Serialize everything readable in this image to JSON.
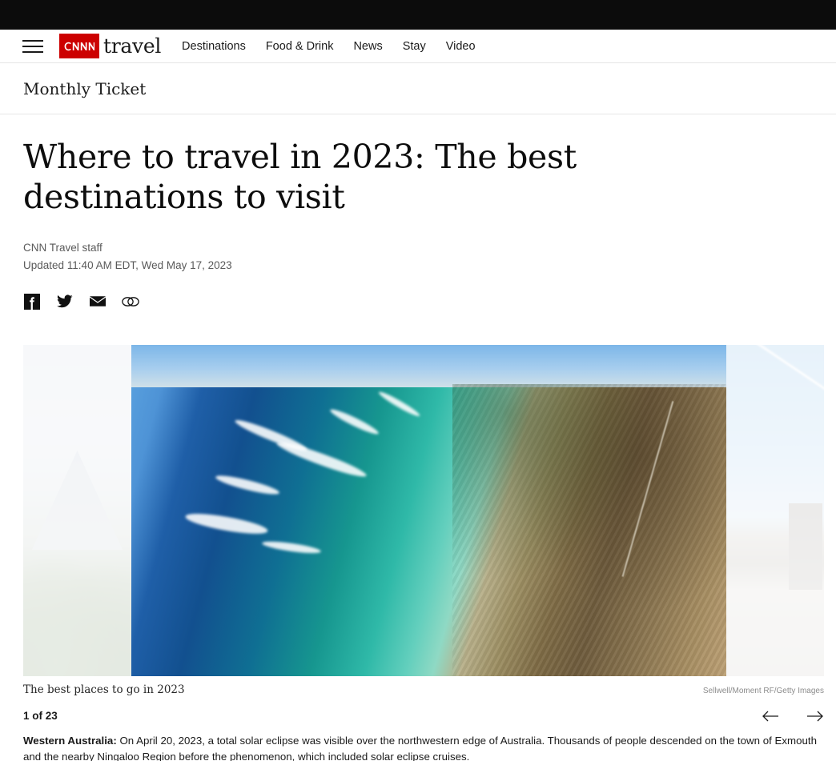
{
  "topbar": {
    "present": true
  },
  "header": {
    "menu_label": "Menu",
    "brand": {
      "logo_text": "CNN",
      "word": "travel",
      "logo_bg": "#cc0000"
    },
    "nav": [
      {
        "label": "Destinations"
      },
      {
        "label": "Food & Drink"
      },
      {
        "label": "News"
      },
      {
        "label": "Stay"
      },
      {
        "label": "Video"
      }
    ]
  },
  "section": {
    "label": "Monthly Ticket"
  },
  "article": {
    "headline": "Where to travel in 2023: The best destinations to visit",
    "author": "CNN Travel staff",
    "timestamp": "Updated 11:40 AM EDT, Wed May 17, 2023",
    "share": [
      {
        "name": "facebook",
        "label": "Share on Facebook"
      },
      {
        "name": "twitter",
        "label": "Share on Twitter"
      },
      {
        "name": "email",
        "label": "Share by email"
      },
      {
        "name": "link",
        "label": "Copy link"
      }
    ]
  },
  "gallery": {
    "caption": "The best places to go in 2023",
    "credit": "Sellwell/Moment RF/Getty Images",
    "counter": "1 of 23",
    "prev_label": "Previous image",
    "next_label": "Next image",
    "slides": [
      {
        "position": "previous",
        "alt": "Misty mountain and forest landscape"
      },
      {
        "position": "current",
        "alt": "Aerial view of turquoise coastline and desert coast of Western Australia"
      },
      {
        "position": "next",
        "alt": "Sunny European city square with contrails in blue sky"
      }
    ]
  },
  "body": {
    "lead_label": "Western Australia:",
    "lead_text": " On April 20, 2023, a total solar eclipse was visible over the northwestern edge of Australia. Thousands of people descended",
    "second_line": "on the town of Exmouth and the nearby Ningaloo Region before the phenomenon, which included solar eclipse cruises."
  },
  "colors": {
    "brand_red": "#cc0000",
    "text": "#1a1a1a",
    "muted": "#5a5a5a",
    "rule": "#e6e6e6"
  }
}
